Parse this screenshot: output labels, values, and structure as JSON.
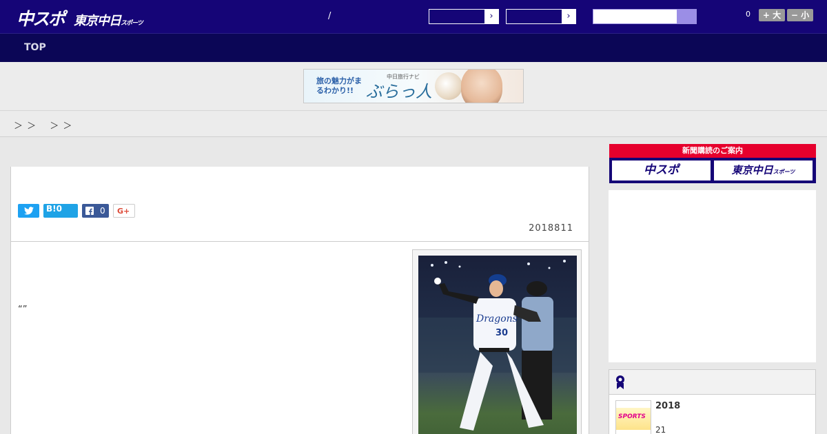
{
  "header": {
    "logo_main": "中スポ",
    "logo_sub": "東京中日",
    "logo_sub_small": "スポーツ",
    "slash": "/",
    "count": "0",
    "font_up_label": "+ 大",
    "font_down_label": "− 小"
  },
  "nav": {
    "top_label": "TOP"
  },
  "banner": {
    "text_line": "旅の魅力がまるわかり!!",
    "navi": "中日旅行ナビ",
    "brand": "ぶらっ人"
  },
  "breadcrumb": {
    "text": "＞ ＞　 ＞ ＞"
  },
  "article": {
    "hatena_label": "B!0",
    "facebook_count": "0",
    "gplus_label": "G+",
    "date": "2018811",
    "quote": "“”"
  },
  "sidebar": {
    "subscribe_label": "新聞購読のご案内",
    "paper_chunichi": "中スポ",
    "paper_tokyo": "東京中日",
    "paper_tokyo_small": "スポーツ",
    "rank_title": "2018",
    "rank_sub": "21",
    "rank_logo": "SPORTS"
  },
  "colors": {
    "header": "#150577",
    "nav": "#0b0656",
    "accent_red": "#e60033",
    "accent_purple": "#7667c4"
  }
}
